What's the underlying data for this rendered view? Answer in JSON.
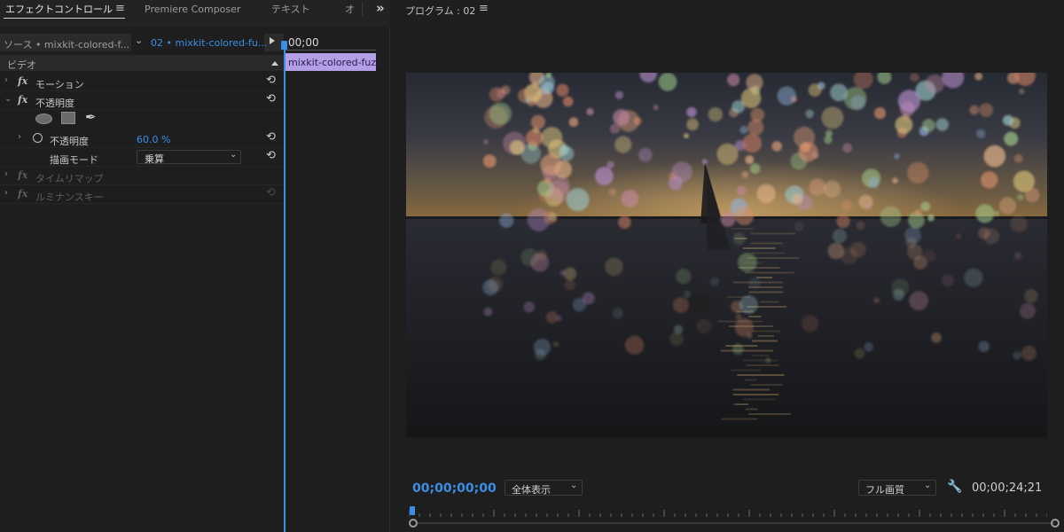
{
  "effect_controls": {
    "tabs": [
      {
        "label": "エフェクトコントロール",
        "active": true
      },
      {
        "label": "Premiere Composer",
        "active": false
      },
      {
        "label": "テキスト",
        "active": false
      },
      {
        "label": "オ",
        "active": false
      }
    ],
    "menu_icon": "hamburger-icon",
    "overflow_icon": "double-chevron-right-icon",
    "source_label": "ソース • mixkit-colored-f...",
    "sequence_label": "02 • mixkit-colored-fu...",
    "timecode": "00;00",
    "clip_label": "mixkit-colored-fuzz",
    "section_header": "ビデオ",
    "rows": {
      "motion": "モーション",
      "opacity": "不透明度",
      "opacity_param": "不透明度",
      "opacity_value": "60.0 %",
      "blend_mode_label": "描画モード",
      "blend_mode_value": "乗算",
      "time_remap": "タイムリマップ",
      "luma_key": "ルミナンスキー"
    },
    "fx_label": "fx",
    "colors": {
      "accent": "#3a8ee6",
      "clip": "#b39fe6"
    }
  },
  "program": {
    "title": "プログラム : 02",
    "current_timecode": "00;00;00;00",
    "zoom_select": "全体表示",
    "quality_select": "フル画質",
    "duration_timecode": "00;00;24;21"
  }
}
